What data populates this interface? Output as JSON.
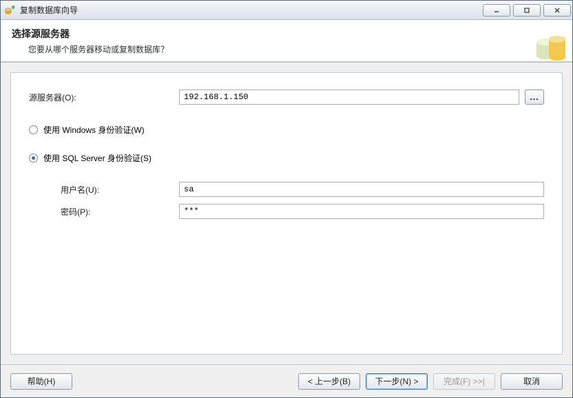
{
  "window": {
    "title": "复制数据库向导"
  },
  "header": {
    "title": "选择源服务器",
    "subtitle": "您要从哪个服务器移动或复制数据库？"
  },
  "form": {
    "source_server_label": "源服务器(O):",
    "source_server_value": "192.168.1.150",
    "browse_label": "...",
    "windows_auth_label": "使用 Windows 身份验证(W)",
    "sql_auth_label": "使用 SQL Server 身份验证(S)",
    "username_label": "用户名(U):",
    "username_value": "sa",
    "password_label": "密码(P):",
    "password_value": "***"
  },
  "footer": {
    "help": "帮助(H)",
    "back": "< 上一步(B)",
    "next": "下一步(N) >",
    "finish": "完成(F) >>|",
    "cancel": "取消"
  }
}
